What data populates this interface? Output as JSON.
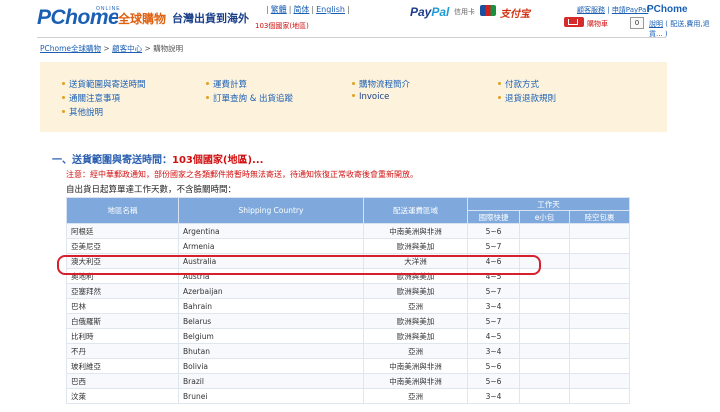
{
  "header": {
    "logo": "PChome",
    "logo_online": "ONLINE",
    "global_badge": "全球購物",
    "tagline": "台灣出貨到海外",
    "countries_link": "103個國家(地區)",
    "lang_links": [
      "繁體",
      "简体",
      "English"
    ],
    "paypal_a": "Pay",
    "paypal_b": "Pal",
    "credit": "信用卡",
    "alipay": "支付宝",
    "service_center": "顧客服務",
    "paypal_apply": "申請PayPal",
    "pchome_small": "PChome",
    "cart_label": "購物車",
    "cart_count": "0",
    "explain_link": "說明",
    "explain_rest": "( 配送,費用,退貨... )"
  },
  "breadcrumb": {
    "items": [
      "PChome全球購物",
      "顧客中心",
      "購物說明"
    ],
    "separator": ">"
  },
  "menu": {
    "col1": [
      "送貨範圍與寄送時間",
      "通關注意事項",
      "其他說明"
    ],
    "col2": [
      "運費計算",
      "訂單查詢 & 出貨追蹤"
    ],
    "col3": [
      "購物流程簡介",
      "Invoice"
    ],
    "col4": [
      "付款方式",
      "退貨退款規則"
    ]
  },
  "section": {
    "title_prefix": "一、送貨範圍與寄送時間：",
    "title_highlight": "103個國家(地區)...",
    "note": "注意：經中華郵政通知，部份國家之各類郵件將暫時無法寄送，待通知恢復正常收寄後會重新開放。",
    "note2": "自出貨日起算單達工作天數，不含臉關時間："
  },
  "table": {
    "headers": {
      "region_name": "地區名稱",
      "shipping_country": "Shipping Country",
      "delivery_zone": "配送運費區域",
      "working_days": "工作天",
      "intl_express": "國際快捷",
      "e_small": "e小包",
      "land_parcel": "陸空包裹"
    },
    "rows": [
      {
        "name": "阿根廷",
        "country": "Argentina",
        "zone": "中南美洲與非洲",
        "express": "5~6",
        "small": "",
        "parcel": ""
      },
      {
        "name": "亞美尼亞",
        "country": "Armenia",
        "zone": "歐洲與美加",
        "express": "5~7",
        "small": "",
        "parcel": ""
      },
      {
        "name": "澳大利亞",
        "country": "Australia",
        "zone": "大洋洲",
        "express": "4~6",
        "small": "",
        "parcel": ""
      },
      {
        "name": "奧地利",
        "country": "Austria",
        "zone": "歐洲與美加",
        "express": "4~5",
        "small": "",
        "parcel": ""
      },
      {
        "name": "亞塞拜然",
        "country": "Azerbaijan",
        "zone": "歐洲與美加",
        "express": "5~7",
        "small": "",
        "parcel": ""
      },
      {
        "name": "巴林",
        "country": "Bahrain",
        "zone": "亞洲",
        "express": "3~4",
        "small": "",
        "parcel": ""
      },
      {
        "name": "白俄羅斯",
        "country": "Belarus",
        "zone": "歐洲與美加",
        "express": "5~7",
        "small": "",
        "parcel": ""
      },
      {
        "name": "比利時",
        "country": "Belgium",
        "zone": "歐洲與美加",
        "express": "4~5",
        "small": "",
        "parcel": ""
      },
      {
        "name": "不丹",
        "country": "Bhutan",
        "zone": "亞洲",
        "express": "3~4",
        "small": "",
        "parcel": ""
      },
      {
        "name": "玻利維亞",
        "country": "Bolivia",
        "zone": "中南美洲與非洲",
        "express": "5~6",
        "small": "",
        "parcel": ""
      },
      {
        "name": "巴西",
        "country": "Brazil",
        "zone": "中南美洲與非洲",
        "express": "5~6",
        "small": "",
        "parcel": ""
      },
      {
        "name": "汶萊",
        "country": "Brunei",
        "zone": "亞洲",
        "express": "3~4",
        "small": "",
        "parcel": ""
      }
    ]
  },
  "colors": {
    "brand_blue": "#1a5fb4",
    "header_row": "#7fa9dc",
    "menu_bg": "#fdf3dd",
    "alert_red": "#d01010",
    "highlight": "#d8202c"
  }
}
